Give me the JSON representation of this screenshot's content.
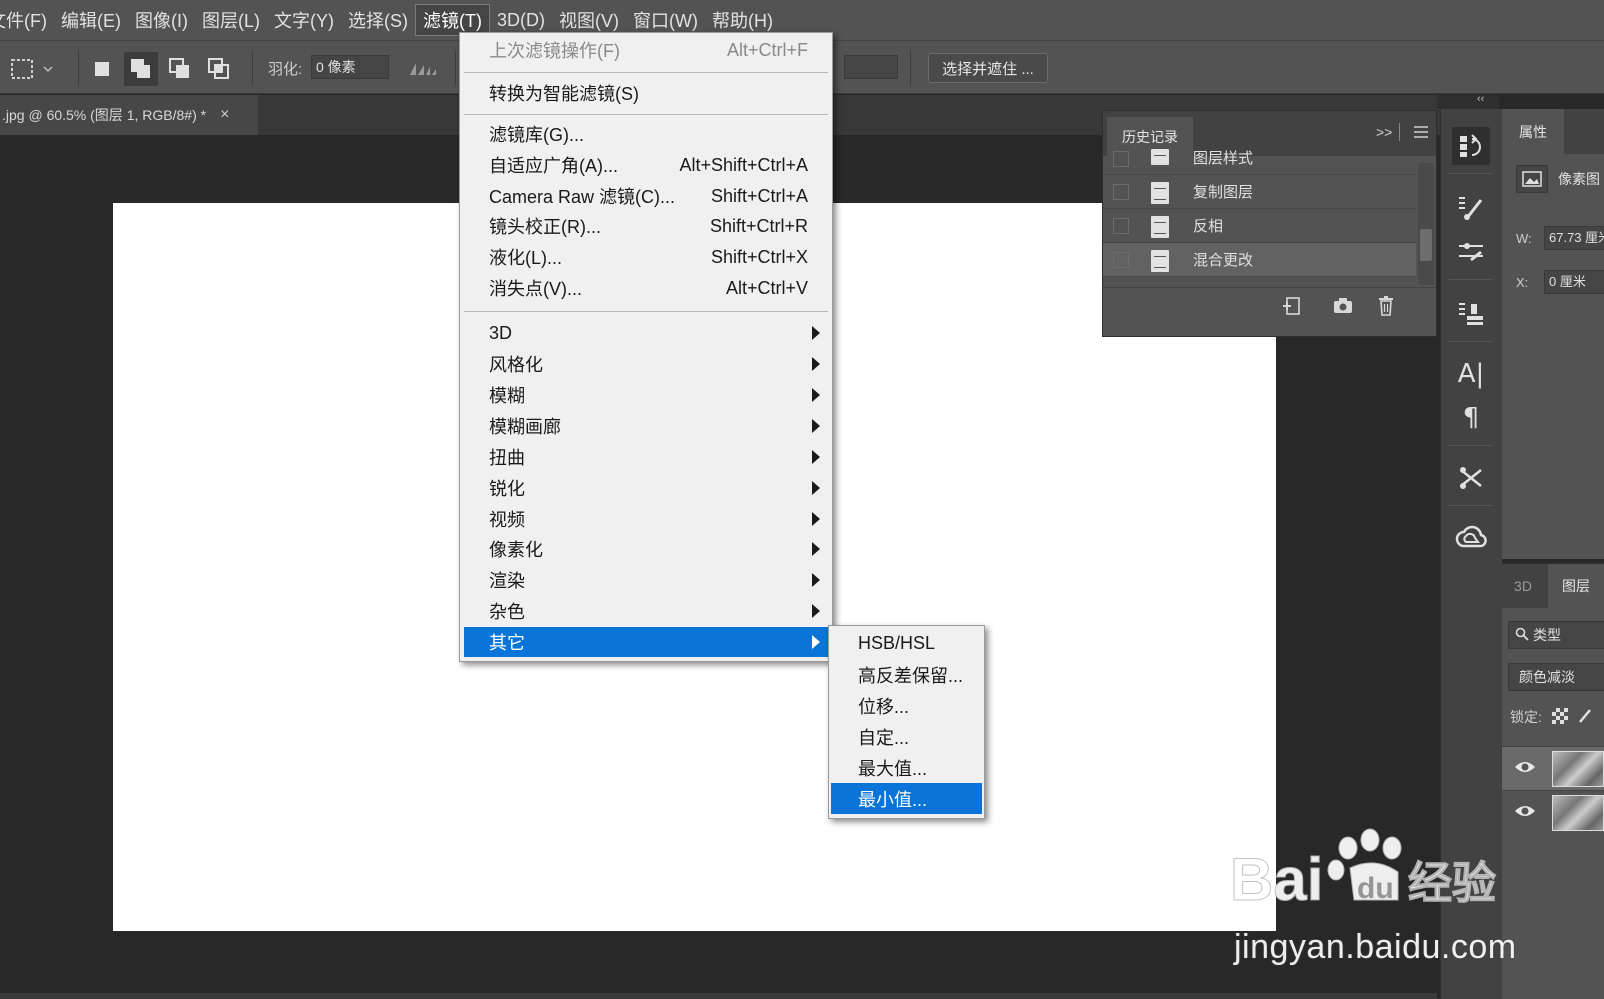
{
  "menubar": {
    "items": [
      "文件(F)",
      "编辑(E)",
      "图像(I)",
      "图层(L)",
      "文字(Y)",
      "选择(S)",
      "滤镜(T)",
      "3D(D)",
      "视图(V)",
      "窗口(W)",
      "帮助(H)"
    ],
    "active": "滤镜(T)"
  },
  "options": {
    "feather_label": "羽化:",
    "feather_value": "0 像素",
    "select_and_mask": "选择并遮住 ..."
  },
  "document": {
    "tab_title": ".jpg @ 60.5% (图层 1, RGB/8#) *",
    "close": "×"
  },
  "filter_menu": {
    "last_filter": {
      "label": "上次滤镜操作(F)",
      "shortcut": "Alt+Ctrl+F"
    },
    "smart_filter": {
      "label": "转换为智能滤镜(S)"
    },
    "items": [
      {
        "label": "滤镜库(G)...",
        "shortcut": ""
      },
      {
        "label": "自适应广角(A)...",
        "shortcut": "Alt+Shift+Ctrl+A"
      },
      {
        "label": "Camera Raw 滤镜(C)...",
        "shortcut": "Shift+Ctrl+A"
      },
      {
        "label": "镜头校正(R)...",
        "shortcut": "Shift+Ctrl+R"
      },
      {
        "label": "液化(L)...",
        "shortcut": "Shift+Ctrl+X"
      },
      {
        "label": "消失点(V)...",
        "shortcut": "Alt+Ctrl+V"
      }
    ],
    "submenus": [
      "3D",
      "风格化",
      "模糊",
      "模糊画廊",
      "扭曲",
      "锐化",
      "视频",
      "像素化",
      "渲染",
      "杂色",
      "其它"
    ],
    "highlighted": "其它"
  },
  "other_submenu": {
    "items": [
      "HSB/HSL",
      "高反差保留...",
      "位移...",
      "自定...",
      "最大值...",
      "最小值..."
    ],
    "highlighted": "最小值..."
  },
  "history_panel": {
    "title": "历史记录",
    "rows": [
      "图层样式",
      "复制图层",
      "反相",
      "混合更改"
    ],
    "current": "混合更改",
    "expand": ">>"
  },
  "properties_panel": {
    "title": "属性",
    "pixel_label": "像素图",
    "w_label": "W:",
    "w_value": "67.73 厘米",
    "x_label": "X:",
    "x_value": "0 厘米"
  },
  "layers_panel": {
    "tab_3d": "3D",
    "tab_layers": "图层",
    "search_kind": "类型",
    "blend_mode": "颜色减淡",
    "lock_label": "锁定:"
  },
  "watermark": {
    "logo_text": "Bai du 经验",
    "url": "jingyan.baidu.com"
  },
  "colors": {
    "menu_highlight": "#0a74d8",
    "ui_bg": "#535353",
    "workspace": "#282828"
  }
}
